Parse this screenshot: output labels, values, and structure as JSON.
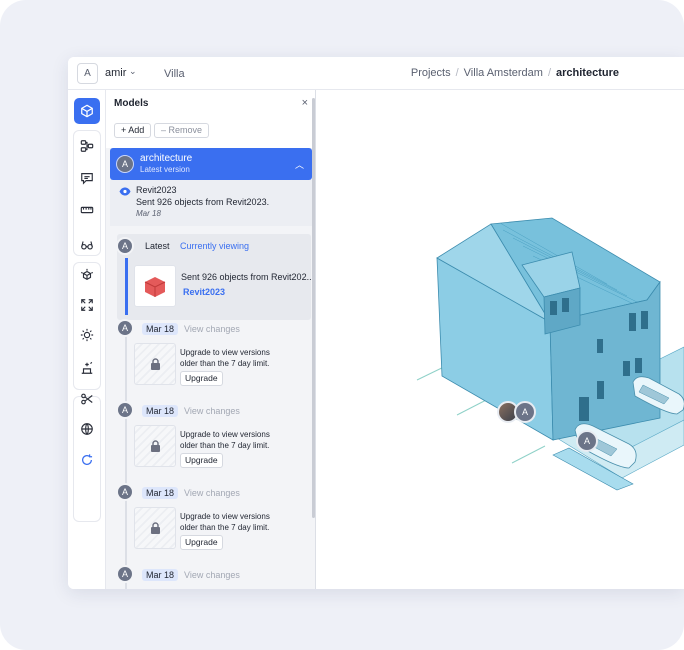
{
  "topbar": {
    "user_initial": "A",
    "user_name": "amir",
    "project": "Villa",
    "breadcrumbs": [
      "Projects",
      "Villa Amsterdam",
      "architecture"
    ]
  },
  "rail": {
    "tools": [
      "cube-icon",
      "nodes-icon",
      "comment-icon",
      "measure-icon",
      "glasses-icon",
      "explode-icon",
      "fullscreen-icon",
      "sun-icon",
      "sparkle-icon",
      "scissors-icon",
      "globe-icon",
      "refresh-icon"
    ]
  },
  "panel": {
    "title": "Models",
    "close": "×",
    "add_label": "+ Add",
    "remove_label": "– Remove",
    "model": {
      "initial": "A",
      "name": "architecture",
      "version": "Latest version"
    },
    "source": {
      "name": "Revit2023",
      "message": "Sent 926 objects from Revit2023.",
      "date": "Mar 18"
    },
    "latest": {
      "initial": "A",
      "label": "Latest",
      "status": "Currently viewing",
      "message": "Sent 926 objects from Revit202...",
      "source": "Revit2023"
    },
    "versions": [
      {
        "initial": "A",
        "date": "Mar 18",
        "action": "View changes",
        "upgrade_text": [
          "Upgrade to view versions",
          "older than the 7 day limit."
        ],
        "upgrade_label": "Upgrade"
      },
      {
        "initial": "A",
        "date": "Mar 18",
        "action": "View changes",
        "upgrade_text": [
          "Upgrade to view versions",
          "older than the 7 day limit."
        ],
        "upgrade_label": "Upgrade"
      },
      {
        "initial": "A",
        "date": "Mar 18",
        "action": "View changes",
        "upgrade_text": [
          "Upgrade to view versions",
          "older than the 7 day limit."
        ],
        "upgrade_label": "Upgrade"
      },
      {
        "initial": "A",
        "date": "Mar 18",
        "action": "View changes"
      }
    ]
  },
  "viewer": {
    "markers": [
      "A",
      "A"
    ],
    "model_color": "#7ec6e0"
  }
}
